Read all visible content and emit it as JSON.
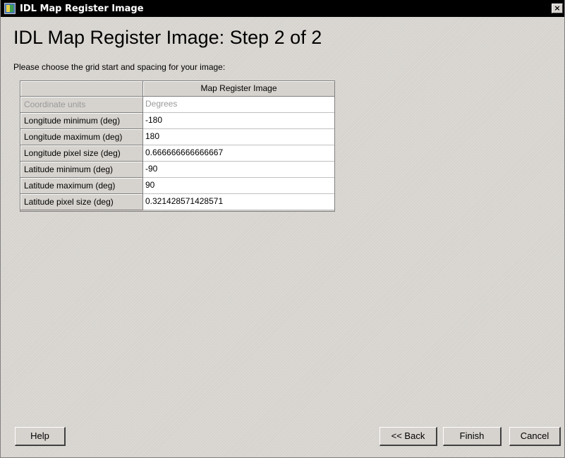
{
  "window": {
    "title": "IDL Map Register Image",
    "close_label": "×"
  },
  "page": {
    "title": "IDL Map Register Image: Step 2 of 2",
    "instructions": "Please choose the grid start and spacing for your image:"
  },
  "grid": {
    "column_header": "Map Register Image",
    "rows": [
      {
        "label": "Coordinate units",
        "value": "Degrees",
        "enabled": false
      },
      {
        "label": "Longitude minimum (deg)",
        "value": "-180",
        "enabled": true
      },
      {
        "label": "Longitude maximum (deg)",
        "value": "180",
        "enabled": true
      },
      {
        "label": "Longitude pixel size (deg)",
        "value": "0.666666666666667",
        "enabled": true
      },
      {
        "label": "Latitude minimum (deg)",
        "value": "-90",
        "enabled": true
      },
      {
        "label": "Latitude maximum (deg)",
        "value": "90",
        "enabled": true
      },
      {
        "label": "Latitude pixel size (deg)",
        "value": "0.321428571428571",
        "enabled": true
      }
    ]
  },
  "buttons": {
    "help": "Help",
    "back": "<< Back",
    "finish": "Finish",
    "cancel": "Cancel"
  },
  "icons": {
    "app": "idl-app-icon",
    "close": "close-icon"
  }
}
